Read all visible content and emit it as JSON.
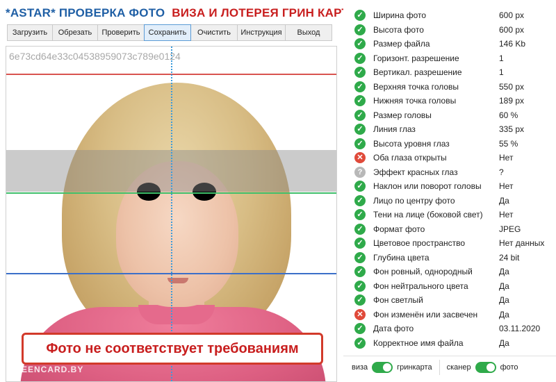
{
  "header": {
    "title_part1": "*ASTAR* ПРОВЕРКА ФОТО",
    "title_part2": "ВИЗА И ЛОТЕРЕЯ ГРИН КАРТА"
  },
  "toolbar": {
    "buttons": [
      "Загрузить",
      "Обрезать",
      "Проверить",
      "Сохранить",
      "Очистить",
      "Инструкция",
      "Выход"
    ],
    "active_index": 3
  },
  "photo": {
    "hash": "6e73cd64e33c04538959073c789e0124",
    "warning": "Фото не соответствует требованиям",
    "watermark": "GREENCARD.BY"
  },
  "checks": [
    {
      "status": "ok",
      "label": "Ширина фото",
      "value": "600 px"
    },
    {
      "status": "ok",
      "label": "Высота фото",
      "value": "600 px"
    },
    {
      "status": "ok",
      "label": "Размер файла",
      "value": "146 Kb"
    },
    {
      "status": "ok",
      "label": "Горизонт. разрешение",
      "value": "1"
    },
    {
      "status": "ok",
      "label": "Вертикал. разрешение",
      "value": "1"
    },
    {
      "status": "ok",
      "label": "Верхняя точка головы",
      "value": "550 px"
    },
    {
      "status": "ok",
      "label": "Нижняя точка головы",
      "value": "189 px"
    },
    {
      "status": "ok",
      "label": "Размер головы",
      "value": "60 %"
    },
    {
      "status": "ok",
      "label": "Линия глаз",
      "value": "335 px"
    },
    {
      "status": "ok",
      "label": "Высота уровня глаз",
      "value": "55 %"
    },
    {
      "status": "bad",
      "label": "Оба глаза открыты",
      "value": "Нет"
    },
    {
      "status": "unknown",
      "label": "Эффект красных глаз",
      "value": "?"
    },
    {
      "status": "ok",
      "label": "Наклон или поворот головы",
      "value": "Нет"
    },
    {
      "status": "ok",
      "label": "Лицо по центру фото",
      "value": "Да"
    },
    {
      "status": "ok",
      "label": "Тени на лице (боковой свет)",
      "value": "Нет"
    },
    {
      "status": "ok",
      "label": "Формат фото",
      "value": "JPEG"
    },
    {
      "status": "ok",
      "label": "Цветовое пространство",
      "value": "Нет данных"
    },
    {
      "status": "ok",
      "label": "Глубина цвета",
      "value": "24 bit"
    },
    {
      "status": "ok",
      "label": "Фон ровный, однородный",
      "value": "Да"
    },
    {
      "status": "ok",
      "label": "Фон нейтрального цвета",
      "value": "Да"
    },
    {
      "status": "ok",
      "label": "Фон светлый",
      "value": "Да"
    },
    {
      "status": "bad",
      "label": "Фон изменён или засвечен",
      "value": "Да"
    },
    {
      "status": "ok",
      "label": "Дата фото",
      "value": "03.11.2020"
    },
    {
      "status": "ok",
      "label": "Корректное имя файла",
      "value": "Да"
    }
  ],
  "footer": {
    "left_off": "виза",
    "left_on": "гринкарта",
    "right_off": "сканер",
    "right_on": "фото"
  },
  "colors": {
    "ok": "#2faa4a",
    "bad": "#e04a3a",
    "unknown": "#b8b8b8",
    "title_blue": "#1f5fa5",
    "title_red": "#c81e1e"
  }
}
